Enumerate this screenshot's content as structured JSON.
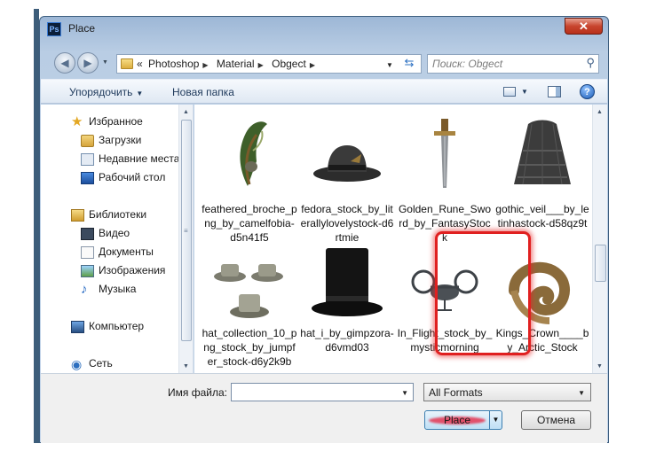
{
  "window": {
    "title": "Place",
    "app_icon": "Ps",
    "close_glyph": "✕"
  },
  "address": {
    "prefix": "«",
    "crumbs": [
      "Photoshop",
      "Material",
      "Obgect"
    ],
    "search_placeholder": "Поиск: Obgect"
  },
  "toolbar": {
    "organize": "Упорядочить",
    "new_folder": "Новая папка"
  },
  "sidebar": {
    "favorites": "Избранное",
    "downloads": "Загрузки",
    "recent": "Недавние места",
    "desktop": "Рабочий стол",
    "libraries": "Библиотеки",
    "video": "Видео",
    "documents": "Документы",
    "images": "Изображения",
    "music": "Музыка",
    "computer": "Компьютер",
    "network": "Сеть"
  },
  "files": [
    {
      "name": "feathered_broche_png_by_camelfobia-d5n41f5",
      "icon": "feather-brooch-icon"
    },
    {
      "name": "fedora_stock_by_literallylovelystock-d6rtmie",
      "icon": "fedora-hat-icon"
    },
    {
      "name": "Golden_Rune_Sword_by_FantasyStock",
      "icon": "sword-icon"
    },
    {
      "name": "gothic_veil___by_letinhastock-d58qz9t",
      "icon": "veil-icon"
    },
    {
      "name": "hat_collection_10_png_stock_by_jumpfer_stock-d6y2k9b",
      "icon": "hat-collection-icon"
    },
    {
      "name": "hat_i_by_gimpzora-d6vmd03",
      "icon": "top-hat-icon"
    },
    {
      "name": "In_Flight_stock_by_mysticmorning",
      "icon": "aircraft-icon"
    },
    {
      "name": "Kings_Crown____by_Arctic_Stock",
      "icon": "horn-icon"
    }
  ],
  "bottom": {
    "filename_label": "Имя файла:",
    "filename_value": "",
    "format": "All Formats",
    "place": "Place",
    "cancel": "Отмена"
  },
  "colors": {
    "accent": "#3c7fb1",
    "selection_highlight": "#e02020",
    "close": "#c8452e"
  }
}
